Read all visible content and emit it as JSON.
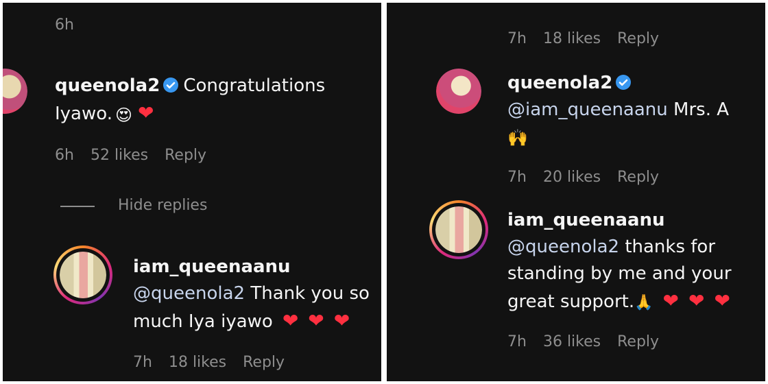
{
  "left": {
    "top_time": "6h",
    "comment": {
      "username": "queenola2",
      "text": "Congratulations Iyawo.",
      "emoji": "😍",
      "time": "6h",
      "likes": "52 likes",
      "reply": "Reply"
    },
    "hide_replies": "Hide replies",
    "reply": {
      "username": "iam_queenaanu",
      "mention": "@queenola2",
      "text_line1": "Thank you so",
      "text_line2": "much Iya iyawo",
      "time": "7h",
      "likes": "18 likes",
      "reply": "Reply"
    }
  },
  "right": {
    "top_meta": {
      "time": "7h",
      "likes": "18 likes",
      "reply": "Reply"
    },
    "comment1": {
      "username": "queenola2",
      "mention": "@iam_queenaanu",
      "text": "Mrs. A",
      "emoji": "🙌",
      "time": "7h",
      "likes": "20 likes",
      "reply": "Reply"
    },
    "comment2": {
      "username": "iam_queenaanu",
      "mention": "@queenola2",
      "text_line1": "thanks for",
      "text_line2": "standing by me and your",
      "text_line3": "great support.",
      "pray_emoji": "🙏",
      "time": "7h",
      "likes": "36 likes",
      "reply": "Reply"
    }
  },
  "icons": {
    "heart": "❤",
    "verified": "verified-badge-icon"
  },
  "colors": {
    "background": "#121212",
    "text": "#f5f5f5",
    "muted": "#8e8e8e",
    "mention": "#c7d4ec",
    "heart": "#ff3040",
    "verified": "#3897f0"
  }
}
